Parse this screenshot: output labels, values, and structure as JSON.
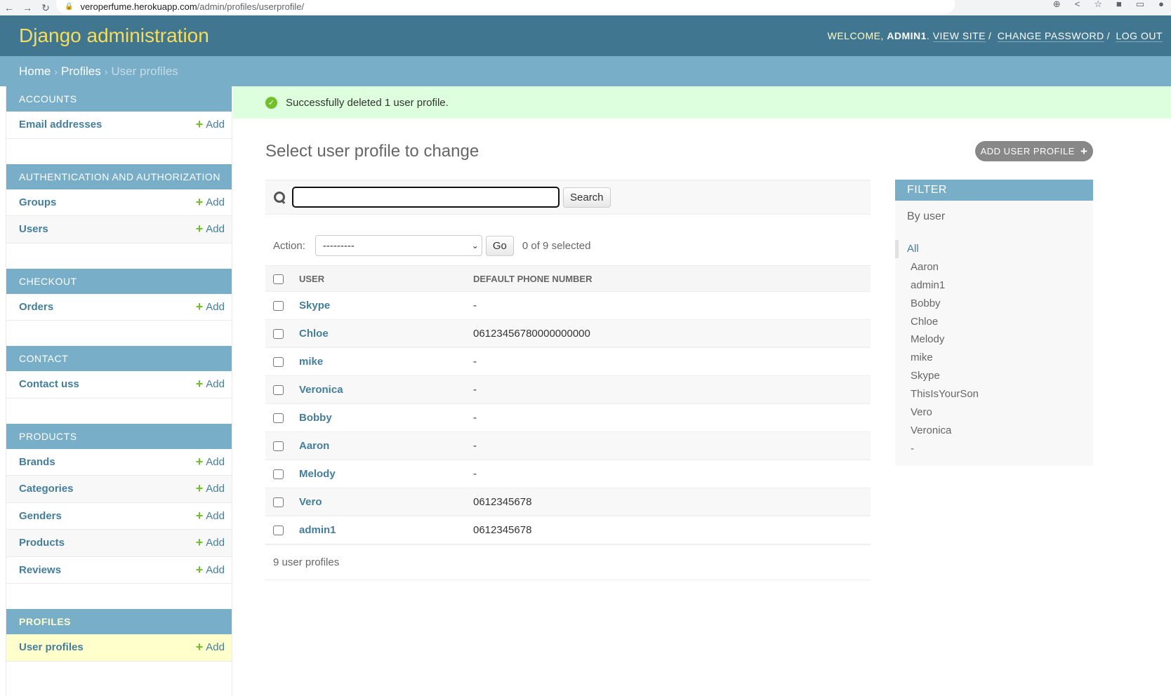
{
  "browser": {
    "url_host": "veroperfume.herokuapp.com",
    "url_path": "/admin/profiles/userprofile/"
  },
  "header": {
    "branding": "Django administration",
    "welcome": "WELCOME, ",
    "username": "ADMIN1",
    "view_site": "VIEW SITE",
    "change_password": "CHANGE PASSWORD",
    "log_out": "LOG OUT"
  },
  "breadcrumbs": {
    "home": "Home",
    "app": "Profiles",
    "current": "User profiles"
  },
  "sidebar": {
    "add_label": "Add",
    "modules": [
      {
        "caption": "Accounts",
        "models": [
          {
            "name": "Email addresses"
          }
        ]
      },
      {
        "caption": "Authentication and Authorization",
        "models": [
          {
            "name": "Groups"
          },
          {
            "name": "Users"
          }
        ]
      },
      {
        "caption": "Checkout",
        "models": [
          {
            "name": "Orders"
          }
        ]
      },
      {
        "caption": "Contact",
        "models": [
          {
            "name": "Contact uss"
          }
        ]
      },
      {
        "caption": "Products",
        "models": [
          {
            "name": "Brands"
          },
          {
            "name": "Categories"
          },
          {
            "name": "Genders"
          },
          {
            "name": "Products"
          },
          {
            "name": "Reviews"
          }
        ]
      },
      {
        "caption": "Profiles",
        "models": [
          {
            "name": "User profiles"
          }
        ]
      }
    ]
  },
  "message": "Successfully deleted 1 user profile.",
  "page_title": "Select user profile to change",
  "add_button": "ADD USER PROFILE",
  "search": {
    "value": "",
    "button": "Search"
  },
  "actions": {
    "label": "Action:",
    "selected_option": "---------",
    "go": "Go",
    "selected_count": "0 of 9 selected"
  },
  "table": {
    "columns": [
      "User",
      "Default phone number"
    ],
    "rows": [
      {
        "user": "Skype",
        "phone": "-"
      },
      {
        "user": "Chloe",
        "phone": "06123456780000000000"
      },
      {
        "user": "mike",
        "phone": "-"
      },
      {
        "user": "Veronica",
        "phone": "-"
      },
      {
        "user": "Bobby",
        "phone": "-"
      },
      {
        "user": "Aaron",
        "phone": "-"
      },
      {
        "user": "Melody",
        "phone": "-"
      },
      {
        "user": "Vero",
        "phone": "0612345678"
      },
      {
        "user": "admin1",
        "phone": "0612345678"
      }
    ]
  },
  "paginator": "9 user profiles",
  "filter": {
    "title": "Filter",
    "subtitle": "By user",
    "options": [
      "All",
      "Aaron",
      "admin1",
      "Bobby",
      "Chloe",
      "Melody",
      "mike",
      "Skype",
      "ThisIsYourSon",
      "Vero",
      "Veronica",
      "-"
    ],
    "selected": "All"
  }
}
